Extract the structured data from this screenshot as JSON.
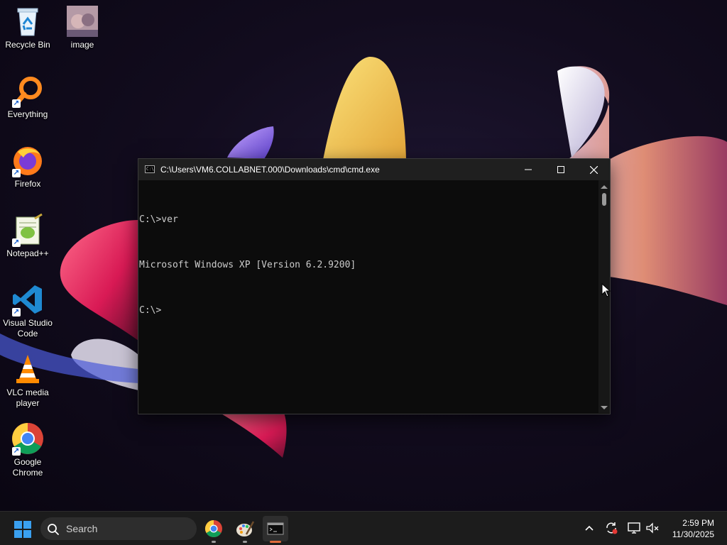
{
  "desktop": {
    "icons": [
      {
        "label": "Recycle Bin",
        "icon": "recycle-bin-icon"
      },
      {
        "label": "image",
        "icon": "image-thumbnail-icon"
      },
      {
        "label": "Everything",
        "icon": "everything-search-icon"
      },
      {
        "label": "Firefox",
        "icon": "firefox-icon"
      },
      {
        "label": "Notepad++",
        "icon": "notepad-plus-plus-icon"
      },
      {
        "label": "Visual Studio Code",
        "icon": "vscode-icon"
      },
      {
        "label": "VLC media player",
        "icon": "vlc-icon"
      },
      {
        "label": "Google Chrome",
        "icon": "chrome-icon"
      }
    ]
  },
  "cmd_window": {
    "title": "C:\\Users\\VM6.COLLABNET.000\\Downloads\\cmd\\cmd.exe",
    "console_lines": [
      "C:\\>ver",
      "Microsoft Windows XP [Version 6.2.9200]",
      "C:\\>"
    ],
    "buttons": {
      "minimize": "minimize-icon",
      "maximize": "maximize-icon",
      "close": "close-icon"
    }
  },
  "taskbar": {
    "search_placeholder": "Search",
    "apps": [
      {
        "name": "Google Chrome",
        "icon": "chrome-icon"
      },
      {
        "name": "Paint",
        "icon": "paint-icon"
      },
      {
        "name": "Command Prompt",
        "icon": "cmd-icon",
        "active": true
      }
    ],
    "tray": [
      "chevron-up-icon",
      "sync-icon",
      "network-icon",
      "volume-muted-icon"
    ],
    "clock": {
      "time": "2:59 PM",
      "date": "11/30/2025"
    }
  },
  "colors": {
    "console_bg": "#0c0c0c",
    "console_text": "#cccccc",
    "titlebar_bg": "#1f1f1f",
    "taskbar_bg": "#1c1c1c",
    "active_indicator": "#e06a3a"
  }
}
